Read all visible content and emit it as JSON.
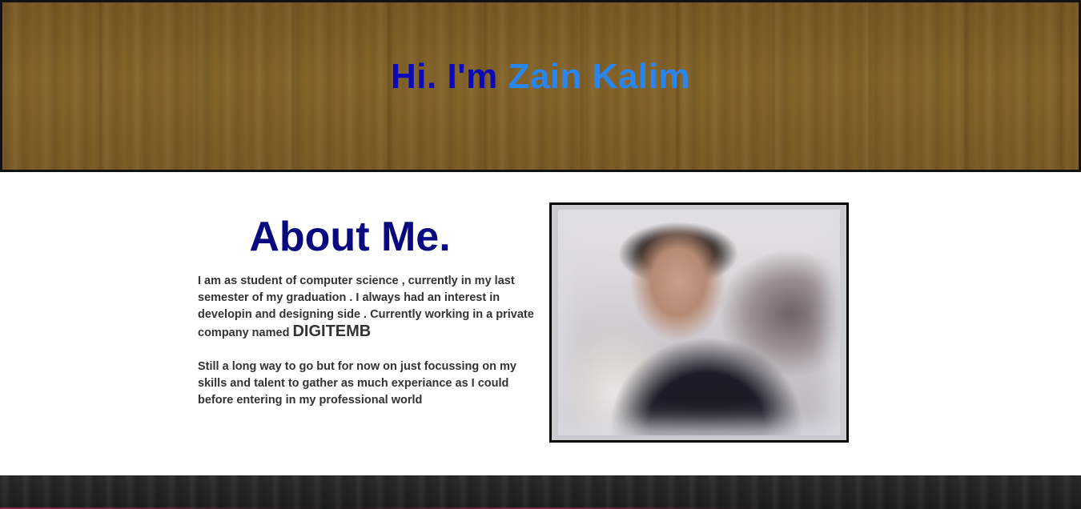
{
  "hero": {
    "greeting": "Hi. I'm ",
    "name": "Zain Kalim",
    "greeting_color": "#0c0ab8",
    "name_color": "#2a86ef"
  },
  "about": {
    "heading": "About Me.",
    "paragraph1_text": "I am as student of computer science , currently in my last semester of my graduation . I always had an interest in developin and designing side . Currently working in a private company named ",
    "company": "DIGITEMB",
    "paragraph2_text": "Still a long way to go but for now on just focussing on my skills and talent to gather as much experiance as I could before entering in my professional world",
    "heading_color": "#0a0a80"
  },
  "photo": {
    "alt": "profile photo"
  }
}
